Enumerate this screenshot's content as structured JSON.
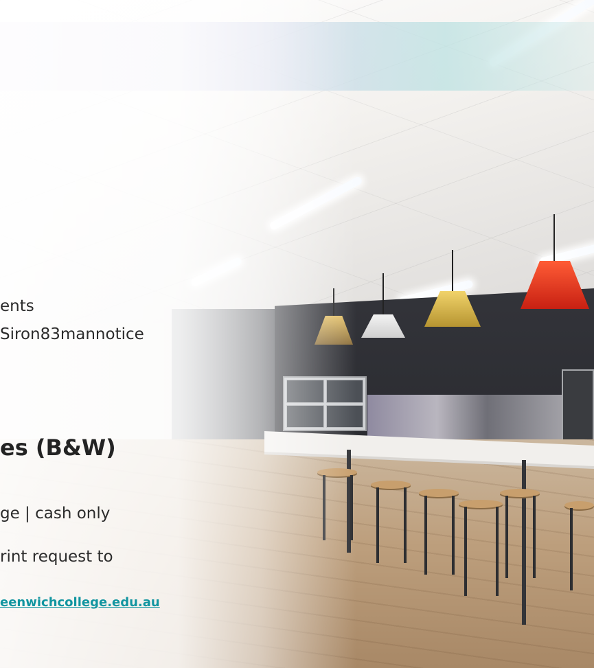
{
  "content": {
    "line_1": "ents",
    "line_2": "Siron83mannotice",
    "heading": "es (B&W)",
    "line_3": "ge | cash only",
    "line_4": "rint request to",
    "email_link": "eenwichcollege.edu.au"
  },
  "colors": {
    "text": "#2b2b2b",
    "link": "#1195a0",
    "top_band_left": "#ddd0eb",
    "top_band_right": "#bee2e2"
  }
}
